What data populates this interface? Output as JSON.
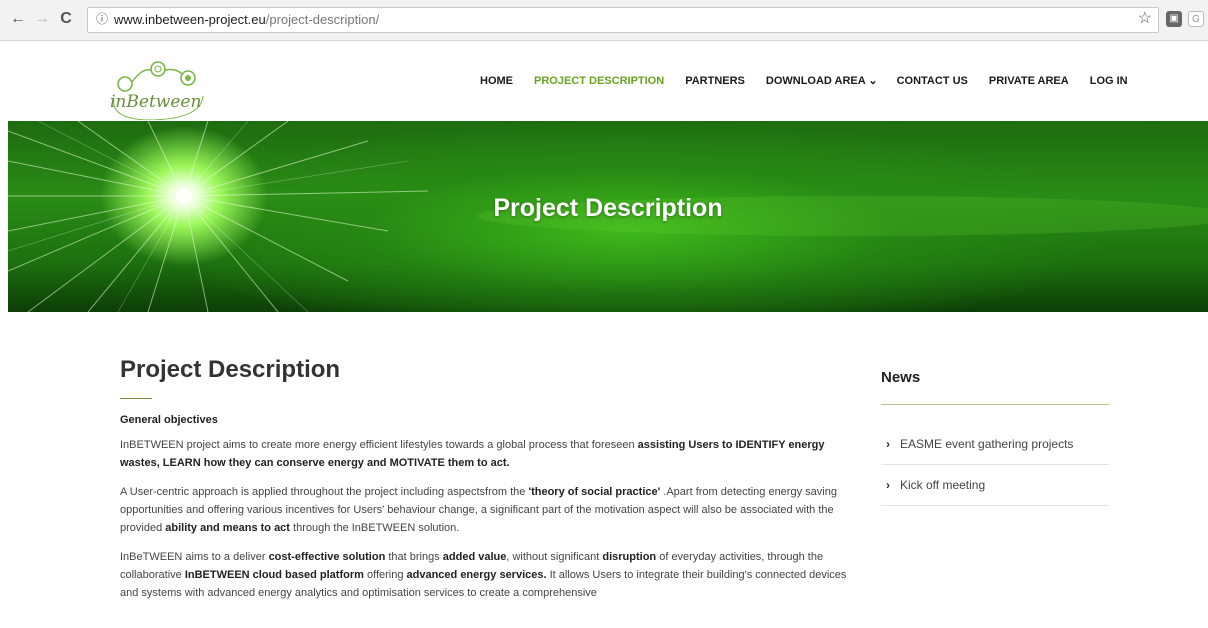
{
  "browser": {
    "back": "←",
    "forward": "→",
    "reload": "C",
    "info_icon": "ⓘ",
    "url_host": "www.inbetween-project.eu",
    "url_path": "/project-description/",
    "star": "☆",
    "ext1": "▣",
    "ext2": "G"
  },
  "site": {
    "logo_text": "inBetween",
    "nav": [
      {
        "label": "HOME"
      },
      {
        "label": "PROJECT DESCRIPTION",
        "active": true
      },
      {
        "label": "PARTNERS"
      },
      {
        "label": "DOWNLOAD AREA ⌄"
      },
      {
        "label": "CONTACT US"
      },
      {
        "label": "PRIVATE AREA"
      },
      {
        "label": "LOG IN"
      }
    ],
    "hero_title": "Project Description"
  },
  "main": {
    "title": "Project Description",
    "section_heading": "General objectives",
    "p1": {
      "a": "InBETWEEN  project  aims to create more energy efficient lifestyles towards a global process that foreseen ",
      "b": "assisting Users to IDENTIFY energy wastes, LEARN how they can conserve energy and MOTIVATE them to act."
    },
    "p2": {
      "a": "A User-centric approach is applied throughout the project including aspectsfrom the ",
      "b": "'theory of social practice'",
      "c": " .Apart from detecting energy saving opportunities and offering various incentives for Users' behaviour change, a significant part of the motivation aspect will also be associated with the provided ",
      "d": "ability and means to act",
      "e": " through the InBETWEEN solution."
    },
    "p3": {
      "a": "InBeTWEEN aims to a deliver ",
      "b": "cost-effective solution",
      "c": " that brings ",
      "d": "added value",
      "e": ", without significant ",
      "f": "disruption",
      "g": " of everyday activities, through the collaborative ",
      "h": "InBETWEEN cloud based platform",
      "i": " offering ",
      "j": "advanced energy services.",
      "k": " It allows Users to integrate their building's connected devices and systems with advanced energy analytics and optimisation services to create a comprehensive"
    }
  },
  "sidebar": {
    "news_title": "News",
    "items": [
      {
        "label": "EASME event gathering projects"
      },
      {
        "label": "Kick off meeting"
      }
    ]
  },
  "colors": {
    "accent": "#6aa321",
    "hero_green": "#2a8c16"
  }
}
